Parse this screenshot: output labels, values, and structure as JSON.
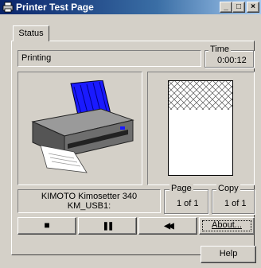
{
  "window": {
    "title": "Printer Test Page",
    "controls": [
      "_",
      "□",
      "×"
    ]
  },
  "tabs": [
    {
      "label": "Status"
    }
  ],
  "status": {
    "state": "Printing"
  },
  "time": {
    "label": "Time",
    "value": "0:00:12"
  },
  "printer": {
    "name": "KIMOTO Kimosetter 340",
    "port": "KM_USB1:"
  },
  "page": {
    "label": "Page",
    "value": "1 of 1"
  },
  "copy": {
    "label": "Copy",
    "value": "1 of 1"
  },
  "controls": {
    "stop_glyph": "■",
    "pause_glyph": "❚❚",
    "rewind_glyph": "◀◀",
    "about_label": "About..."
  },
  "help_label": "Help",
  "colors": {
    "titlebar": "#0a246a",
    "face": "#d4d0c8",
    "printer_tray": "#1a1aff"
  },
  "icons": {
    "title": "printer-icon",
    "preview": "page-preview-icon",
    "illustration": "printer-illustration-icon"
  }
}
